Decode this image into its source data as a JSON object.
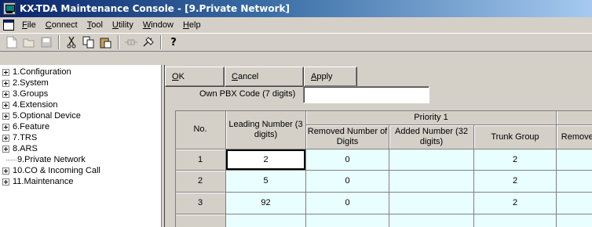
{
  "window": {
    "title": "KX-TDA Maintenance Console - [9.Private Network]"
  },
  "menu": {
    "items": [
      {
        "label": "File",
        "accel": "F",
        "rest": "ile"
      },
      {
        "label": "Connect",
        "accel": "C",
        "rest": "onnect"
      },
      {
        "label": "Tool",
        "accel": "T",
        "rest": "ool"
      },
      {
        "label": "Utility",
        "accel": "U",
        "rest": "tility"
      },
      {
        "label": "Window",
        "accel": "W",
        "rest": "indow"
      },
      {
        "label": "Help",
        "accel": "H",
        "rest": "elp"
      }
    ]
  },
  "toolbar": {
    "icons": [
      "new-file-icon",
      "open-folder-icon",
      "save-icon",
      "cut-icon",
      "copy-icon",
      "paste-icon",
      "connect-icon",
      "disconnect-icon",
      "help-icon"
    ],
    "help_glyph": "?"
  },
  "tree": {
    "items": [
      {
        "label": "1.Configuration",
        "expandable": true
      },
      {
        "label": "2.System",
        "expandable": true
      },
      {
        "label": "3.Groups",
        "expandable": true
      },
      {
        "label": "4.Extension",
        "expandable": true
      },
      {
        "label": "5.Optional Device",
        "expandable": true
      },
      {
        "label": "6.Feature",
        "expandable": true
      },
      {
        "label": "7.TRS",
        "expandable": true
      },
      {
        "label": "8.ARS",
        "expandable": true
      },
      {
        "label": "9.Private Network",
        "expandable": false,
        "selected": true
      },
      {
        "label": "10.CO & Incoming Call",
        "expandable": true
      },
      {
        "label": "11.Maintenance",
        "expandable": true
      }
    ]
  },
  "buttons": {
    "ok": {
      "accel": "O",
      "rest": "K"
    },
    "cancel": {
      "accel": "C",
      "rest": "ancel"
    },
    "apply": {
      "accel": "A",
      "rest": "pply"
    }
  },
  "own_pbx": {
    "label": "Own PBX Code (7 digits)",
    "value": ""
  },
  "grid": {
    "headers": {
      "no": "No.",
      "leading_number": "Leading Number (3 digits)",
      "priority": "Priority 1",
      "removed": "Removed Number of Digits",
      "added": "Added Number (32 digits)",
      "trunk": "Trunk Group",
      "removed_cut": "Remove of"
    },
    "rows": [
      {
        "no": "1",
        "leading": "2",
        "removed": "0",
        "added": "",
        "trunk": "2"
      },
      {
        "no": "2",
        "leading": "5",
        "removed": "0",
        "added": "",
        "trunk": "2"
      },
      {
        "no": "3",
        "leading": "92",
        "removed": "0",
        "added": "",
        "trunk": "2"
      }
    ]
  }
}
